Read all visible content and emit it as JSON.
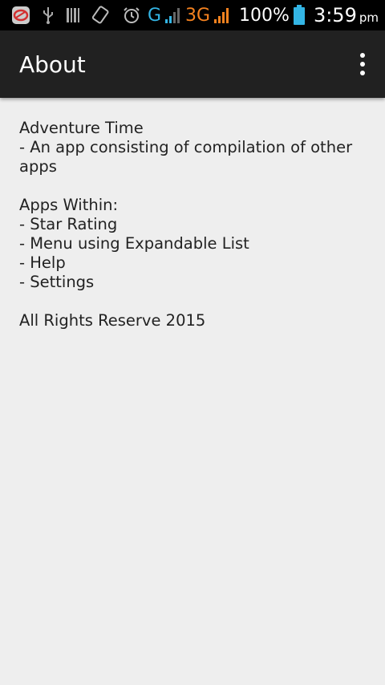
{
  "status_bar": {
    "network_g": "G",
    "network_3g": "3G",
    "battery_percent": "100%",
    "time": "3:59",
    "ampm": "pm",
    "icons": [
      "app-notification-icon",
      "usb-icon",
      "barcode-icon",
      "screen-rotate-icon",
      "alarm-icon",
      "signal-icon",
      "battery-icon"
    ],
    "colors": {
      "g": "#33b5e5",
      "threeg": "#f5821f",
      "battery": "#33b5e5"
    }
  },
  "action_bar": {
    "title": "About",
    "overflow_icon": "more-vert-icon"
  },
  "about": {
    "app_name": "Adventure Time",
    "app_desc_line1": "- An app consisting of compilation of other",
    "app_desc_line2": "apps",
    "apps_heading": "Apps Within:",
    "apps": [
      "- Star Rating",
      "- Menu using Expandable List",
      "- Help",
      "- Settings"
    ],
    "copyright": "All Rights Reserve 2015"
  }
}
